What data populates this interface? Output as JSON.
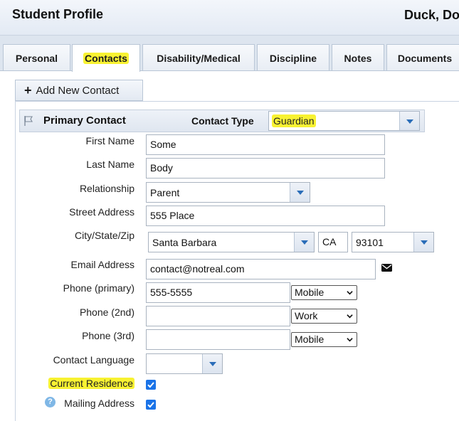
{
  "header": {
    "title": "Student Profile",
    "student_name": "Duck, Do"
  },
  "tabs": [
    {
      "label": "Personal",
      "active": false
    },
    {
      "label": "Contacts",
      "active": true,
      "highlighted": true
    },
    {
      "label": "Disability/Medical",
      "active": false
    },
    {
      "label": "Discipline",
      "active": false
    },
    {
      "label": "Notes",
      "active": false
    },
    {
      "label": "Documents",
      "active": false
    }
  ],
  "add_contact_label": "Add New Contact",
  "contact": {
    "panel_title": "Primary Contact",
    "contact_type_label": "Contact Type",
    "contact_type_value": "Guardian",
    "first_name_label": "First Name",
    "first_name": "Some",
    "last_name_label": "Last Name",
    "last_name": "Body",
    "relationship_label": "Relationship",
    "relationship": "Parent",
    "street_label": "Street Address",
    "street": "555 Place",
    "city_state_zip_label": "City/State/Zip",
    "city": "Santa Barbara",
    "state": "CA",
    "zip": "93101",
    "email_label": "Email Address",
    "email": "contact@notreal.com",
    "phone_primary_label": "Phone (primary)",
    "phone_primary": "555-5555",
    "phone_primary_type": "Mobile",
    "phone_2nd_label": "Phone (2nd)",
    "phone_2nd": "",
    "phone_2nd_type": "Work",
    "phone_3rd_label": "Phone (3rd)",
    "phone_3rd": "",
    "phone_3rd_type": "Mobile",
    "language_label": "Contact Language",
    "language": "",
    "current_residence_label": "Current Residence",
    "current_residence": true,
    "mailing_address_label": "Mailing Address",
    "mailing_address": true
  },
  "colors": {
    "highlight": "#f8f232",
    "accent": "#2a6db8",
    "checkbox": "#1a73e8"
  }
}
